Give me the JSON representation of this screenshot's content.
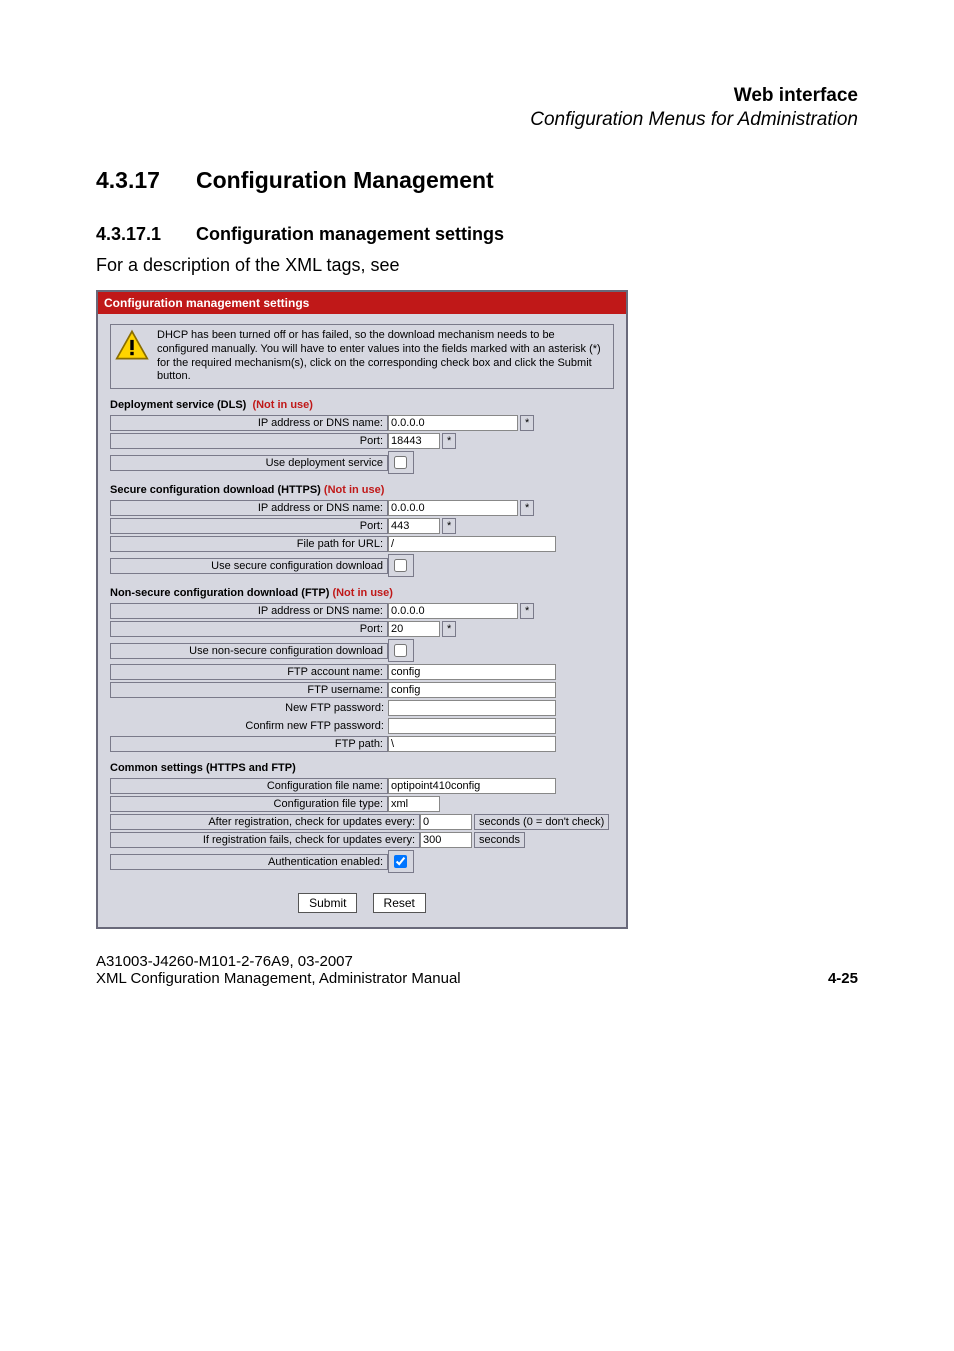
{
  "header": {
    "title": "Web interface",
    "subtitle": "Configuration Menus for Administration"
  },
  "section": {
    "num": "4.3.17",
    "title": "Configuration Management"
  },
  "subsection": {
    "num": "4.3.17.1",
    "title": "Configuration management settings"
  },
  "intro": "For a description of the XML tags, see",
  "panel": {
    "title": "Configuration management settings",
    "info": "DHCP has been turned off or has failed, so the download mechanism needs to be configured manually. You will have to enter values into the fields marked with an asterisk (*) for the required mechanism(s), click on the corresponding check box and click the Submit button.",
    "not_in_use": "(Not in use)",
    "dls": {
      "heading": "Deployment service (DLS)",
      "ip_label": "IP address or DNS name:",
      "ip_value": "0.0.0.0",
      "port_label": "Port:",
      "port_value": "18443",
      "use_label": "Use deployment service"
    },
    "https": {
      "heading": "Secure configuration download (HTTPS)",
      "ip_label": "IP address or DNS name:",
      "ip_value": "0.0.0.0",
      "port_label": "Port:",
      "port_value": "443",
      "path_label": "File path for URL:",
      "path_value": "/",
      "use_label": "Use secure configuration download"
    },
    "ftp": {
      "heading": "Non-secure configuration download (FTP)",
      "ip_label": "IP address or DNS name:",
      "ip_value": "0.0.0.0",
      "port_label": "Port:",
      "port_value": "20",
      "use_label": "Use non-secure configuration download",
      "account_label": "FTP account name:",
      "account_value": "config",
      "user_label": "FTP username:",
      "user_value": "config",
      "newpw_label": "New FTP password:",
      "confirmpw_label": "Confirm new FTP password:",
      "path_label": "FTP path:",
      "path_value": "\\"
    },
    "common": {
      "heading": "Common settings (HTTPS and FTP)",
      "file_name_label": "Configuration file name:",
      "file_name_value": "optipoint410config",
      "file_type_label": "Configuration file type:",
      "file_type_value": "xml",
      "after_reg_label": "After registration, check for updates every:",
      "after_reg_value": "0",
      "after_reg_trail": "seconds (0 = don't check)",
      "if_fail_label": "If registration fails, check for updates every:",
      "if_fail_value": "300",
      "if_fail_trail": "seconds",
      "auth_label": "Authentication enabled:"
    },
    "asterisk": "*",
    "submit": "Submit",
    "reset": "Reset"
  },
  "footer": {
    "line1": "A31003-J4260-M101-2-76A9, 03-2007",
    "line2": "XML Configuration Management, Administrator Manual",
    "page": "4-25"
  }
}
